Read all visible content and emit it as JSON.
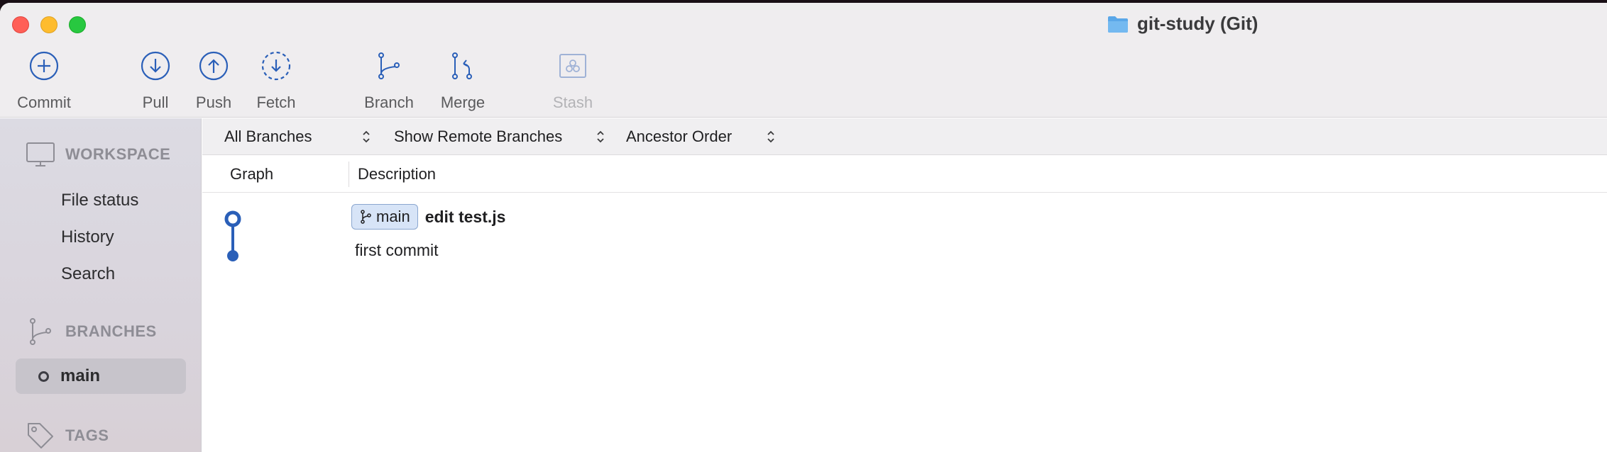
{
  "window": {
    "title": "git-study (Git)"
  },
  "toolbar": {
    "commit": {
      "label": "Commit",
      "icon": "plus-circle-icon"
    },
    "pull": {
      "label": "Pull",
      "icon": "arrow-down-circle-icon"
    },
    "push": {
      "label": "Push",
      "icon": "arrow-up-circle-icon"
    },
    "fetch": {
      "label": "Fetch",
      "icon": "dashed-arrow-down-circle-icon"
    },
    "branch": {
      "label": "Branch",
      "icon": "branch-icon"
    },
    "merge": {
      "label": "Merge",
      "icon": "merge-icon"
    },
    "stash": {
      "label": "Stash",
      "icon": "stash-icon",
      "disabled": true
    }
  },
  "sidebar": {
    "workspace": {
      "label": "WORKSPACE",
      "icon": "monitor-icon"
    },
    "workspace_items": [
      "File status",
      "History",
      "Search"
    ],
    "branches": {
      "label": "BRANCHES",
      "icon": "branch-icon"
    },
    "branch_items": [
      {
        "name": "main",
        "selected": true
      }
    ],
    "tags": {
      "label": "TAGS",
      "icon": "tag-icon"
    }
  },
  "filters": {
    "branches": "All Branches",
    "remote": "Show Remote Branches",
    "order": "Ancestor Order"
  },
  "columns": {
    "graph": "Graph",
    "description": "Description"
  },
  "commits": [
    {
      "branch_tag": "main",
      "message": "edit test.js",
      "head": true
    },
    {
      "branch_tag": "",
      "message": "first commit",
      "head": false
    }
  ],
  "colors": {
    "accent": "#2a5fb8",
    "branch_tag_bg": "#d7e4f7",
    "close": "#ff5f57",
    "minimize": "#febc2e",
    "zoom": "#28c840"
  }
}
